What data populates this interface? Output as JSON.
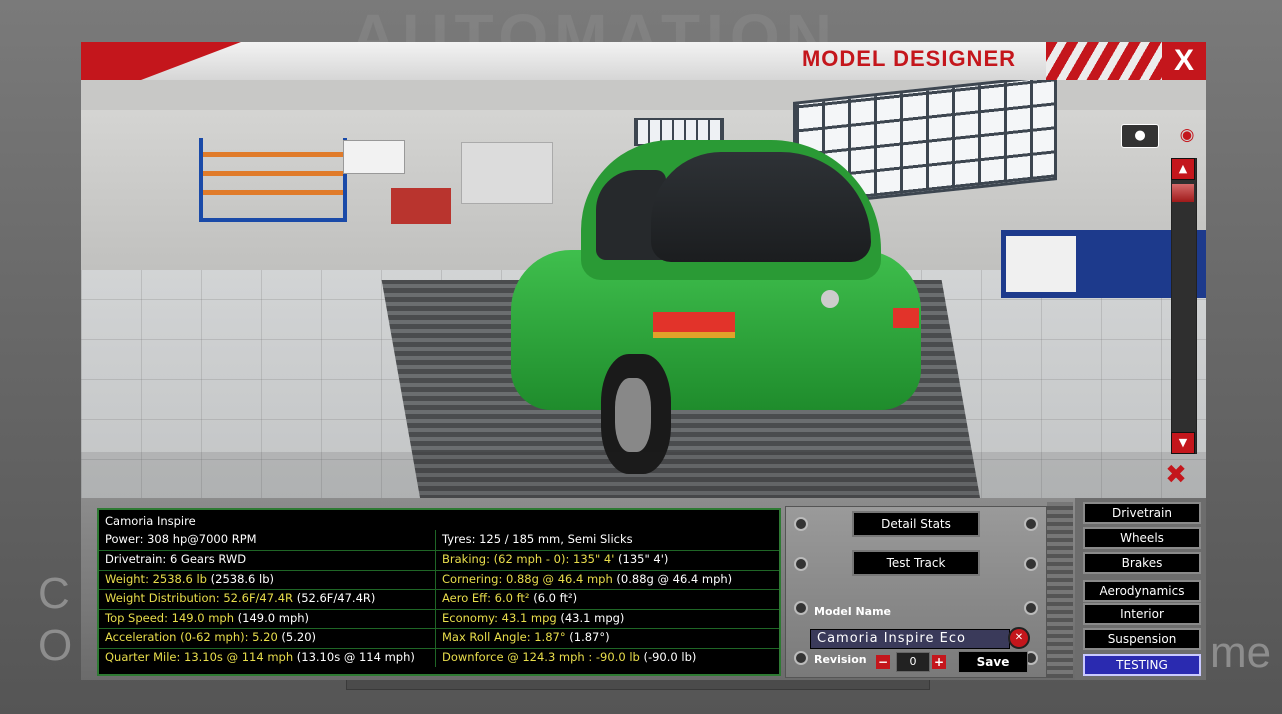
{
  "window": {
    "title": "MODEL DESIGNER",
    "close_label": "X"
  },
  "background": {
    "logo_text": "AUTOMATION",
    "left_text_1": "C",
    "left_text_2": "O",
    "right_text": "me"
  },
  "stats": {
    "title": "Camoria Inspire",
    "rows": [
      {
        "left": "Power: 308 hp@7000 RPM",
        "left_highlight": false,
        "right": "Tyres: 125 / 185 mm, Semi Slicks",
        "right_highlight": false
      },
      {
        "left": "Drivetrain: 6 Gears RWD",
        "left_highlight": false,
        "right_main": "Braking: (62 mph - 0): 135\" 4'",
        "right_extra": " (135\" 4')",
        "right_highlight": true
      },
      {
        "left_main": "Weight: 2538.6 lb",
        "left_extra": " (2538.6 lb)",
        "left_highlight": true,
        "right_main": "Cornering: 0.88g @ 46.4 mph",
        "right_extra": " (0.88g @ 46.4 mph)",
        "right_highlight": true
      },
      {
        "left_main": "Weight Distribution: 52.6F/47.4R",
        "left_extra": " (52.6F/47.4R)",
        "left_highlight": true,
        "right_main": "Aero Eff: 6.0 ft²",
        "right_extra": " (6.0 ft²)",
        "right_highlight": true
      },
      {
        "left_main": "Top Speed: 149.0 mph",
        "left_extra": " (149.0 mph)",
        "left_highlight": true,
        "right_main": "Economy: 43.1 mpg",
        "right_extra": " (43.1 mpg)",
        "right_highlight": true
      },
      {
        "left_main": "Acceleration (0-62 mph): 5.20",
        "left_extra": " (5.20)",
        "left_highlight": true,
        "right_main": "Max Roll Angle: 1.87°",
        "right_extra": " (1.87°)",
        "right_highlight": true
      },
      {
        "left_main": "Quarter Mile: 13.10s @ 114 mph",
        "left_extra": " (13.10s @ 114 mph)",
        "left_highlight": true,
        "right_main": "Downforce @ 124.3 mph : -90.0 lb",
        "right_extra": " (-90.0 lb)",
        "right_highlight": true
      }
    ]
  },
  "actions": {
    "detail_stats": "Detail Stats",
    "test_track": "Test Track"
  },
  "model": {
    "name_label": "Model Name",
    "name_value": "Camoria Inspire Eco",
    "revision_label": "Revision",
    "revision_value": "0",
    "minus": "−",
    "plus": "+",
    "save_label": "Save"
  },
  "nav": {
    "items": [
      "Drivetrain",
      "Wheels",
      "Brakes",
      "Aerodynamics",
      "Interior",
      "Suspension",
      "TESTING"
    ],
    "active": "TESTING"
  },
  "viewport": {
    "camera_icon": "camera-icon",
    "eye_icon": "eye-icon",
    "hide_icon": "eye-off-icon",
    "up_arrow": "▲",
    "down_arrow": "▼"
  },
  "colors": {
    "accent_red": "#c4161c",
    "stat_highlight": "#e9de4c",
    "car_green": "#2fa83b",
    "active_tab": "#2a2ab0"
  }
}
